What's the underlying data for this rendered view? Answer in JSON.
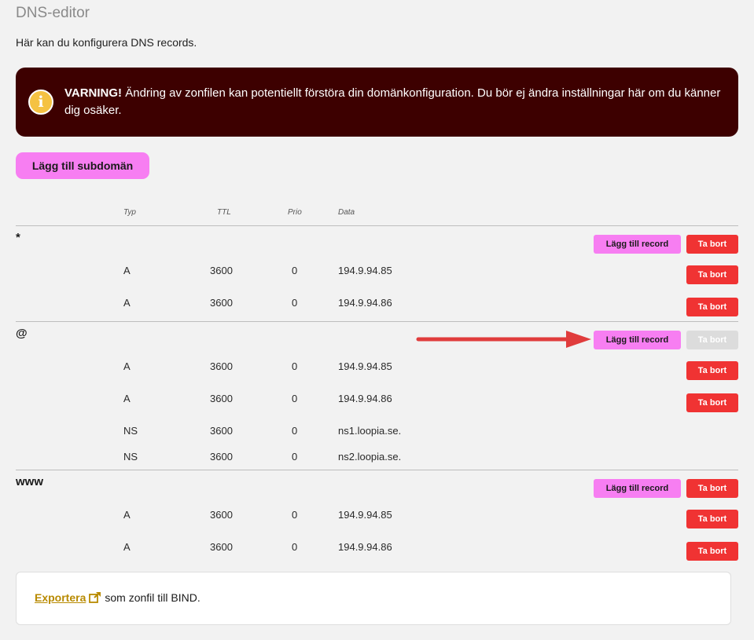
{
  "page": {
    "title": "DNS-editor",
    "intro": "Här kan du konfigurera DNS records."
  },
  "warning": {
    "bold": "VARNING!",
    "text": " Ändring av zonfilen kan potentiellt förstöra din domänkonfiguration. Du bör ej ändra inställningar här om du känner dig osäker.",
    "icon": "info-icon"
  },
  "add_subdomain_label": "Lägg till subdomän",
  "columns": {
    "typ": "Typ",
    "ttl": "TTL",
    "prio": "Prio",
    "data": "Data"
  },
  "buttons": {
    "add_record": "Lägg till record",
    "delete": "Ta bort"
  },
  "groups": [
    {
      "name": "*",
      "records": [
        {
          "type": "A",
          "ttl": "3600",
          "prio": "0",
          "data": "194.9.94.85"
        },
        {
          "type": "A",
          "ttl": "3600",
          "prio": "0",
          "data": "194.9.94.86"
        }
      ]
    },
    {
      "name": "@",
      "records": [
        {
          "type": "A",
          "ttl": "3600",
          "prio": "0",
          "data": "194.9.94.85"
        },
        {
          "type": "A",
          "ttl": "3600",
          "prio": "0",
          "data": "194.9.94.86"
        },
        {
          "type": "NS",
          "ttl": "3600",
          "prio": "0",
          "data": "ns1.loopia.se."
        },
        {
          "type": "NS",
          "ttl": "3600",
          "prio": "0",
          "data": "ns2.loopia.se."
        }
      ]
    },
    {
      "name": "www",
      "records": [
        {
          "type": "A",
          "ttl": "3600",
          "prio": "0",
          "data": "194.9.94.85"
        },
        {
          "type": "A",
          "ttl": "3600",
          "prio": "0",
          "data": "194.9.94.86"
        }
      ]
    }
  ],
  "export": {
    "link": "Exportera",
    "rest": " som zonfil till BIND.",
    "icon": "external-link-icon"
  },
  "colors": {
    "warning_bg": "#3d0000",
    "pink_button": "#f77ef2",
    "delete_button": "#f03333",
    "export_link": "#b88a00",
    "arrow": "#e03c3c"
  }
}
